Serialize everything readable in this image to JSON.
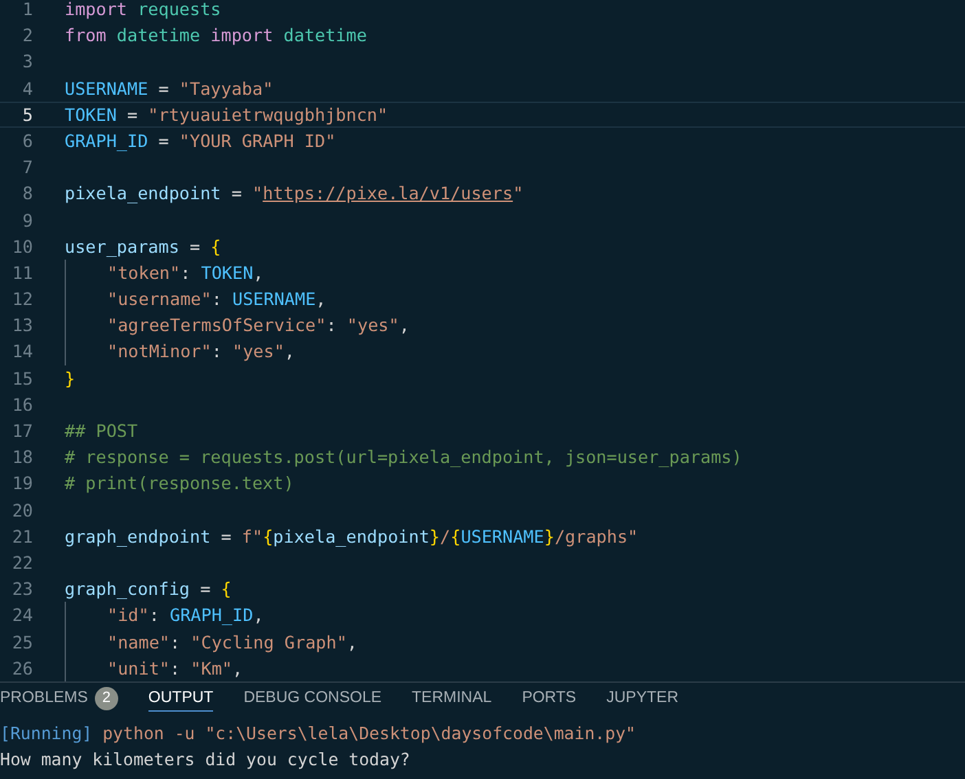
{
  "editor": {
    "lines": [
      {
        "number": "1",
        "current": false,
        "tokens": [
          {
            "kind": "keyword",
            "text": "import "
          },
          {
            "kind": "module",
            "text": "requests"
          }
        ]
      },
      {
        "number": "2",
        "current": false,
        "tokens": [
          {
            "kind": "keyword",
            "text": "from "
          },
          {
            "kind": "module",
            "text": "datetime "
          },
          {
            "kind": "keyword",
            "text": "import "
          },
          {
            "kind": "module",
            "text": "datetime"
          }
        ]
      },
      {
        "number": "3",
        "current": false
      },
      {
        "number": "4",
        "current": false,
        "tokens": [
          {
            "kind": "constant",
            "text": "USERNAME"
          },
          {
            "kind": "plain",
            "text": " = "
          },
          {
            "kind": "string",
            "text": "\"Tayyaba\""
          }
        ]
      },
      {
        "number": "5",
        "current": true,
        "tokens": [
          {
            "kind": "constant",
            "text": "TOKEN"
          },
          {
            "kind": "plain",
            "text": " = "
          },
          {
            "kind": "string",
            "text": "\"rtyuauietrwqugbhjbncn\""
          }
        ]
      },
      {
        "number": "6",
        "current": false,
        "tokens": [
          {
            "kind": "constant",
            "text": "GRAPH_ID"
          },
          {
            "kind": "plain",
            "text": " = "
          },
          {
            "kind": "string",
            "text": "\"YOUR GRAPH ID\""
          }
        ]
      },
      {
        "number": "7",
        "current": false
      },
      {
        "number": "8",
        "current": false,
        "tokens": [
          {
            "kind": "variable",
            "text": "pixela_endpoint"
          },
          {
            "kind": "plain",
            "text": " = "
          },
          {
            "kind": "string",
            "text": "\""
          },
          {
            "kind": "link",
            "text": "https://pixe.la/v1/users"
          },
          {
            "kind": "string",
            "text": "\""
          }
        ]
      },
      {
        "number": "9",
        "current": false
      },
      {
        "number": "10",
        "current": false,
        "tokens": [
          {
            "kind": "variable",
            "text": "user_params"
          },
          {
            "kind": "plain",
            "text": " = "
          },
          {
            "kind": "brace",
            "text": "{"
          }
        ]
      },
      {
        "number": "11",
        "current": false,
        "indented": true,
        "tokens": [
          {
            "kind": "string",
            "text": "\"token\""
          },
          {
            "kind": "plain",
            "text": ": "
          },
          {
            "kind": "constant",
            "text": "TOKEN"
          },
          {
            "kind": "plain",
            "text": ","
          }
        ]
      },
      {
        "number": "12",
        "current": false,
        "indented": true,
        "tokens": [
          {
            "kind": "string",
            "text": "\"username\""
          },
          {
            "kind": "plain",
            "text": ": "
          },
          {
            "kind": "constant",
            "text": "USERNAME"
          },
          {
            "kind": "plain",
            "text": ","
          }
        ]
      },
      {
        "number": "13",
        "current": false,
        "indented": true,
        "tokens": [
          {
            "kind": "string",
            "text": "\"agreeTermsOfService\""
          },
          {
            "kind": "plain",
            "text": ": "
          },
          {
            "kind": "string",
            "text": "\"yes\""
          },
          {
            "kind": "plain",
            "text": ","
          }
        ]
      },
      {
        "number": "14",
        "current": false,
        "indented": true,
        "tokens": [
          {
            "kind": "string",
            "text": "\"notMinor\""
          },
          {
            "kind": "plain",
            "text": ": "
          },
          {
            "kind": "string",
            "text": "\"yes\""
          },
          {
            "kind": "plain",
            "text": ","
          }
        ]
      },
      {
        "number": "15",
        "current": false,
        "tokens": [
          {
            "kind": "brace",
            "text": "}"
          }
        ]
      },
      {
        "number": "16",
        "current": false
      },
      {
        "number": "17",
        "current": false,
        "tokens": [
          {
            "kind": "comment",
            "text": "## POST"
          }
        ]
      },
      {
        "number": "18",
        "current": false,
        "tokens": [
          {
            "kind": "comment",
            "text": "# response = requests.post(url=pixela_endpoint, json=user_params)"
          }
        ]
      },
      {
        "number": "19",
        "current": false,
        "tokens": [
          {
            "kind": "comment",
            "text": "# print(response.text)"
          }
        ]
      },
      {
        "number": "20",
        "current": false
      },
      {
        "number": "21",
        "current": false,
        "tokens": [
          {
            "kind": "variable",
            "text": "graph_endpoint"
          },
          {
            "kind": "plain",
            "text": " = "
          },
          {
            "kind": "string",
            "text": "f\""
          },
          {
            "kind": "brace",
            "text": "{"
          },
          {
            "kind": "variable",
            "text": "pixela_endpoint"
          },
          {
            "kind": "brace",
            "text": "}"
          },
          {
            "kind": "string",
            "text": "/"
          },
          {
            "kind": "brace",
            "text": "{"
          },
          {
            "kind": "constant",
            "text": "USERNAME"
          },
          {
            "kind": "brace",
            "text": "}"
          },
          {
            "kind": "string",
            "text": "/graphs\""
          }
        ]
      },
      {
        "number": "22",
        "current": false
      },
      {
        "number": "23",
        "current": false,
        "tokens": [
          {
            "kind": "variable",
            "text": "graph_config"
          },
          {
            "kind": "plain",
            "text": " = "
          },
          {
            "kind": "brace",
            "text": "{"
          }
        ]
      },
      {
        "number": "24",
        "current": false,
        "indented": true,
        "tokens": [
          {
            "kind": "string",
            "text": "\"id\""
          },
          {
            "kind": "plain",
            "text": ": "
          },
          {
            "kind": "constant",
            "text": "GRAPH_ID"
          },
          {
            "kind": "plain",
            "text": ","
          }
        ]
      },
      {
        "number": "25",
        "current": false,
        "indented": true,
        "tokens": [
          {
            "kind": "string",
            "text": "\"name\""
          },
          {
            "kind": "plain",
            "text": ": "
          },
          {
            "kind": "string",
            "text": "\"Cycling Graph\""
          },
          {
            "kind": "plain",
            "text": ","
          }
        ]
      },
      {
        "number": "26",
        "current": false,
        "indented": true,
        "tokens": [
          {
            "kind": "string",
            "text": "\"unit\""
          },
          {
            "kind": "plain",
            "text": ": "
          },
          {
            "kind": "string",
            "text": "\"Km\""
          },
          {
            "kind": "plain",
            "text": ","
          }
        ]
      }
    ]
  },
  "panel": {
    "tabs": [
      {
        "label": "PROBLEMS",
        "badge": "2",
        "selected": false
      },
      {
        "label": "OUTPUT",
        "selected": true
      },
      {
        "label": "DEBUG CONSOLE",
        "selected": false
      },
      {
        "label": "TERMINAL",
        "selected": false
      },
      {
        "label": "PORTS",
        "selected": false
      },
      {
        "label": "JUPYTER",
        "selected": false
      }
    ],
    "output": [
      {
        "tokens": [
          {
            "kind": "status",
            "text": "[Running]"
          },
          {
            "kind": "command",
            "text": " python -u \"c:\\Users\\lela\\Desktop\\daysofcode\\main.py\""
          }
        ]
      },
      {
        "tokens": [
          {
            "kind": "plain",
            "text": "How many kilometers did you cycle today?"
          }
        ]
      }
    ]
  }
}
